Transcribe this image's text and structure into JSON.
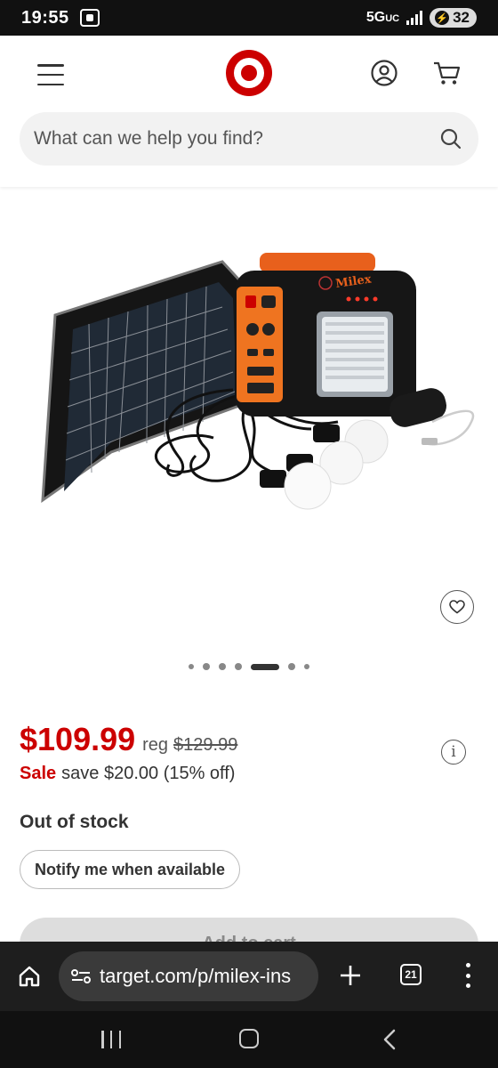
{
  "status_bar": {
    "time": "19:55",
    "network": "5G",
    "network_suffix": "UC",
    "battery": "32"
  },
  "header": {
    "search_placeholder": "What can we help you find?",
    "brand_color": "#cc0000"
  },
  "carousel": {
    "total": 7,
    "active_index": 4
  },
  "product": {
    "price": "$109.99",
    "reg_label": "reg",
    "reg_price": "$129.99",
    "sale_label": "Sale",
    "savings": "save $20.00 (15% off)",
    "stock_status": "Out of stock",
    "notify_label": "Notify me when available",
    "add_to_cart_label": "Add to cart",
    "image_brand_text": "Milex"
  },
  "browser": {
    "url": "target.com/p/milex-ins",
    "tab_count": "21"
  }
}
